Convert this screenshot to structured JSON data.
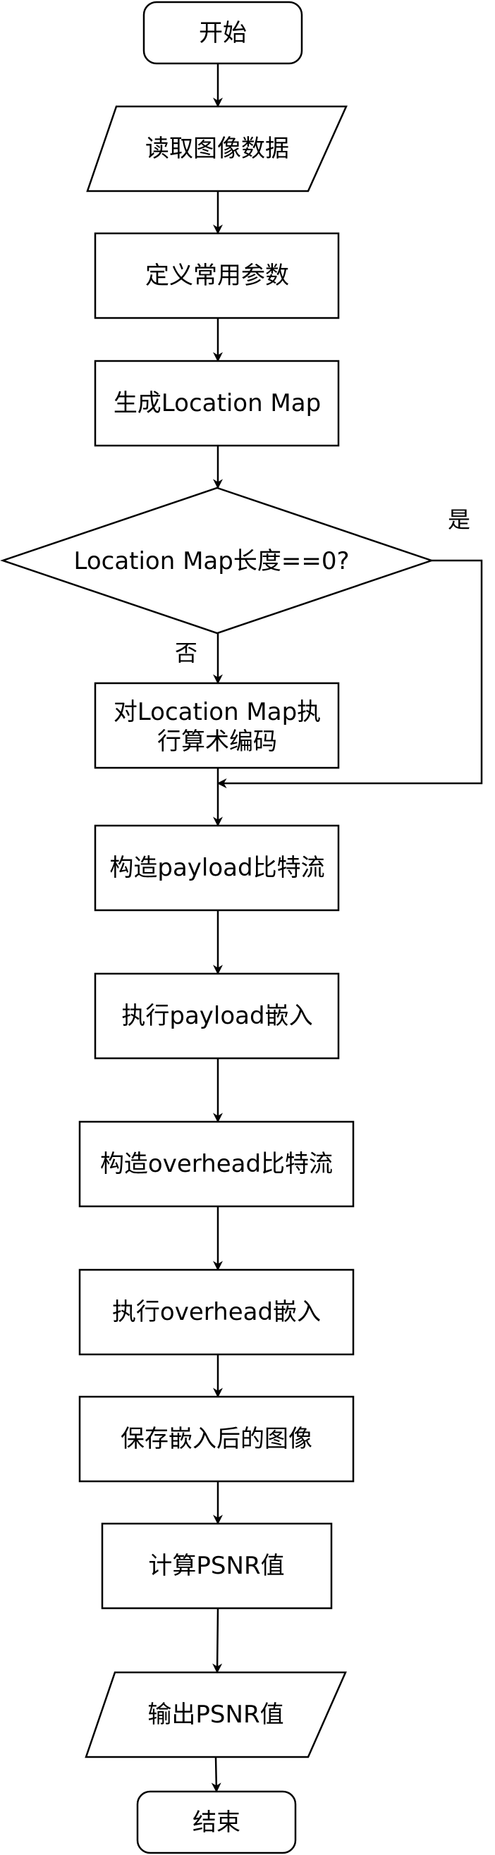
{
  "nodes": {
    "start": "开始",
    "read_image": "读取图像数据",
    "define_params": "定义常用参数",
    "gen_location_map": "生成Location Map",
    "decision": "Location Map长度==0?",
    "arith_encode_line1": "对Location Map执",
    "arith_encode_line2": "行算术编码",
    "build_payload": "构造payload比特流",
    "embed_payload": "执行payload嵌入",
    "build_overhead": "构造overhead比特流",
    "embed_overhead": "执行overhead嵌入",
    "save_image": "保存嵌入后的图像",
    "calc_psnr": "计算PSNR值",
    "output_psnr": "输出PSNR值",
    "end": "结束"
  },
  "edges": {
    "yes_label": "是",
    "no_label": "否"
  }
}
